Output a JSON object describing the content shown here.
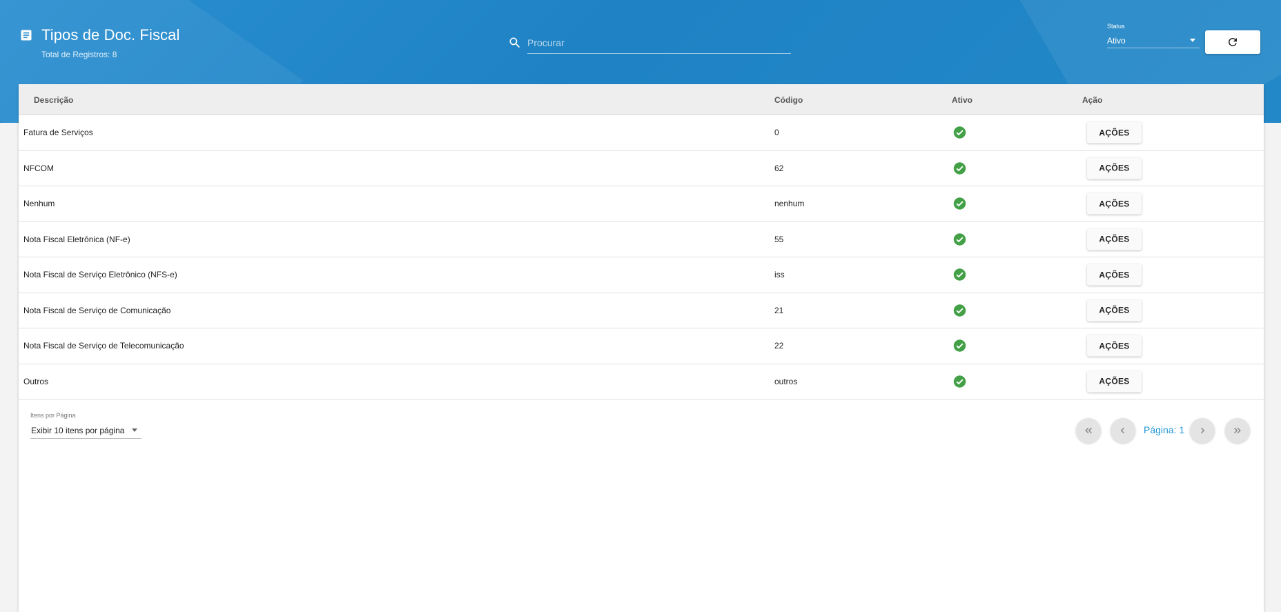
{
  "header": {
    "title": "Tipos de Doc. Fiscal",
    "subtitle": "Total de Registros: 8",
    "search_placeholder": "Procurar",
    "status_label": "Status",
    "status_value": "Ativo",
    "icons": [
      "doc-icon",
      "search-icon",
      "refresh-icon"
    ]
  },
  "table": {
    "columns": [
      "Descrição",
      "Código",
      "Ativo",
      "Ação"
    ],
    "rows": [
      {
        "descricao": "Fatura de Serviços",
        "codigo": "0",
        "ativo": true,
        "acao": "AÇÕES"
      },
      {
        "descricao": "NFCOM",
        "codigo": "62",
        "ativo": true,
        "acao": "AÇÕES"
      },
      {
        "descricao": "Nenhum",
        "codigo": "nenhum",
        "ativo": true,
        "acao": "AÇÕES"
      },
      {
        "descricao": "Nota Fiscal Eletrônica (NF-e)",
        "codigo": "55",
        "ativo": true,
        "acao": "AÇÕES"
      },
      {
        "descricao": "Nota Fiscal de Serviço Eletrônico (NFS-e)",
        "codigo": "iss",
        "ativo": true,
        "acao": "AÇÕES"
      },
      {
        "descricao": "Nota Fiscal de Serviço de Comunicação",
        "codigo": "21",
        "ativo": true,
        "acao": "AÇÕES"
      },
      {
        "descricao": "Nota Fiscal de Serviço de Telecomunicação",
        "codigo": "22",
        "ativo": true,
        "acao": "AÇÕES"
      },
      {
        "descricao": "Outros",
        "codigo": "outros",
        "ativo": true,
        "acao": "AÇÕES"
      }
    ]
  },
  "pagination": {
    "items_label": "Itens por Página",
    "items_value": "Exibir 10 itens por página",
    "page_label": "Página: 1"
  },
  "colors": {
    "header_blue": "#2388c8",
    "active_green": "#43a047",
    "page_text_blue": "#2196d6"
  }
}
